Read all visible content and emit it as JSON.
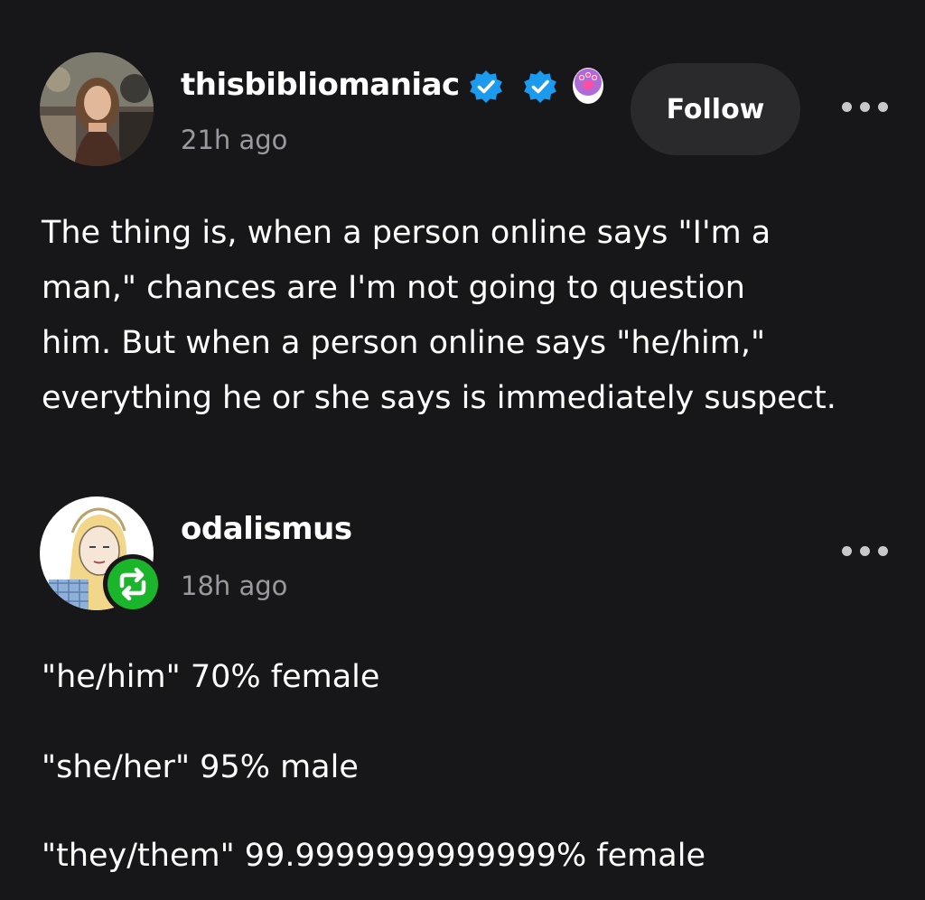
{
  "original_post": {
    "username": "thisbibliomaniac",
    "timestamp": "21h ago",
    "follow_label": "Follow",
    "badges": [
      "verified-badge-icon",
      "verified-badge-icon",
      "paw-badge-icon"
    ],
    "body_lines": [
      "The thing is, when a person online says \"I'm a",
      "man,\" chances are I'm not going to question",
      "him. But when a person online says \"he/him,\"",
      "everything he or she says is immediately suspect."
    ]
  },
  "reply_post": {
    "username": "odalismus",
    "timestamp": "18h ago",
    "reblog_icon": "reblog-icon",
    "lines": [
      "\"he/him\" 70% female",
      "\"she/her\" 95% male",
      "\"they/them\" 99.9999999999999% female"
    ]
  },
  "colors": {
    "background": "#171719",
    "text": "#ffffff",
    "muted": "#9a9a9e",
    "follow_button_bg": "#2a2a2d",
    "verified_blue": "#1a9bf0",
    "reblog_green": "#1bb52c"
  }
}
